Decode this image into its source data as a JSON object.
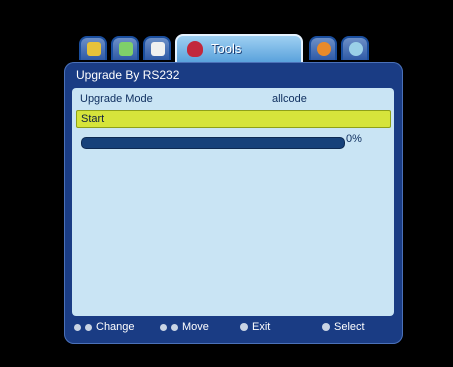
{
  "tabs": {
    "active_label": "Tools",
    "icons": [
      "satellite-icon",
      "antenna-icon",
      "channel-icon",
      "tools-icon",
      "media-icon",
      "settings-icon"
    ]
  },
  "panel": {
    "title": "Upgrade By RS232",
    "upgrade_mode": {
      "label": "Upgrade Mode",
      "value": "allcode"
    },
    "start": {
      "label": "Start"
    },
    "progress": {
      "fraction": 0.0,
      "label": "0%"
    }
  },
  "footer": {
    "change": "Change",
    "move": "Move",
    "exit": "Exit",
    "select": "Select"
  },
  "colors": {
    "panel_bg": "#1a3c84",
    "content_bg": "#c9e4f4",
    "highlight": "#d6e43b"
  }
}
